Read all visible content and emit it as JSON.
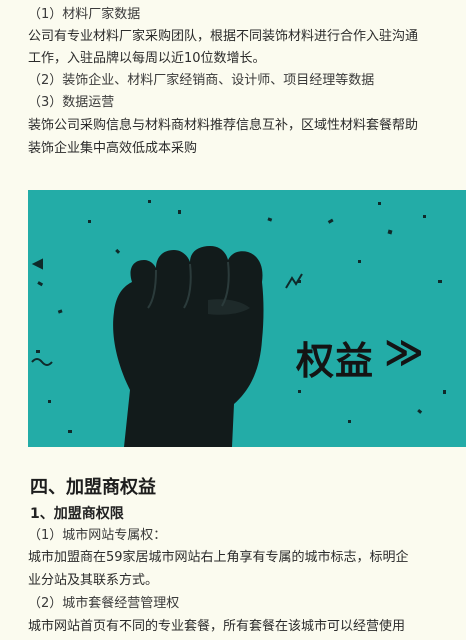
{
  "top": {
    "item1_title": "（1）材料厂家数据",
    "item1_line1": "公司有专业材料厂家采购团队，根据不同装饰材料进行合作入驻沟通",
    "item1_line2": "工作，入驻品牌以每周以近10位数增长。",
    "item2_title": "（2）装饰企业、材料厂家经销商、设计师、项目经理等数据",
    "item3_title": "（3）数据运营",
    "item3_line1": "装饰公司采购信息与材料商材料推荐信息互补，区域性材料套餐帮助",
    "item3_line2": "装饰企业集中高效低成本采购"
  },
  "banner": {
    "title": "权益",
    "arrows": "≫",
    "bg_color": "#23aca7",
    "icon": "raised-fist-icon"
  },
  "bottom": {
    "section_heading": "四、加盟商权益",
    "sub_heading": "1、加盟商权限",
    "item1_title": "（1）城市网站专属权：",
    "item1_line1": "城市加盟商在59家居城市网站右上角享有专属的城市标志，标明企",
    "item1_line2": "业分站及其联系方式。",
    "item2_title": "（2）城市套餐经营管理权",
    "item2_line1": "城市网站首页有不同的专业套餐，所有套餐在该城市可以经营使用"
  }
}
